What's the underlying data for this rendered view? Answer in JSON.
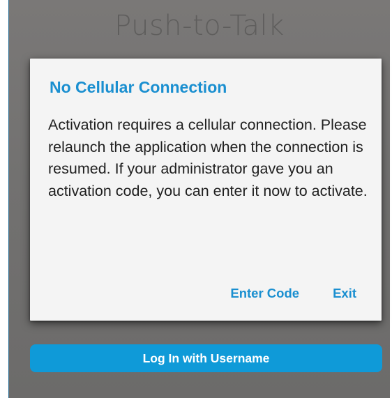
{
  "app": {
    "title": "Push-to-Talk"
  },
  "dialog": {
    "title": "No Cellular Connection",
    "message": "Activation requires a cellular connection. Please relaunch the application when the connection is resumed. If your administrator gave you an activation code, you can enter it now to activate.",
    "buttons": {
      "enter_code": "Enter Code",
      "exit": "Exit"
    }
  },
  "login": {
    "button_label": "Log In with Username"
  },
  "colors": {
    "accent": "#1a8fd0",
    "login_button": "#0f9ad8",
    "overlay": "#727170",
    "dialog_background": "#f4f4f4"
  }
}
